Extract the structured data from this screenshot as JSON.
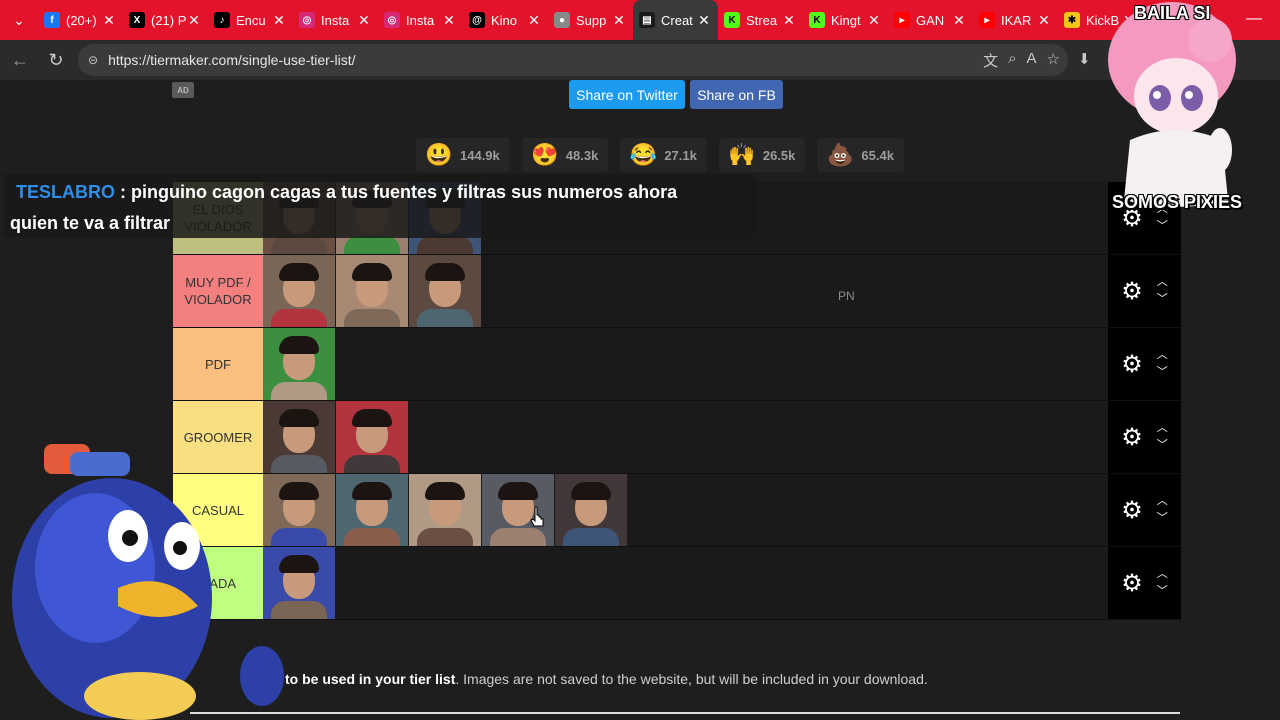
{
  "browser": {
    "tabs": [
      {
        "label": "(20+)",
        "icon": "facebook-icon",
        "color": "#1877f2",
        "glyph": "f"
      },
      {
        "label": "(21) P",
        "icon": "x-icon",
        "color": "#000000",
        "glyph": "X"
      },
      {
        "label": "Encu",
        "icon": "tiktok-icon",
        "color": "#000000",
        "glyph": "♪"
      },
      {
        "label": "Insta",
        "icon": "instagram-icon",
        "color": "#d62976",
        "glyph": "◎"
      },
      {
        "label": "Insta",
        "icon": "instagram-icon",
        "color": "#d62976",
        "glyph": "◎"
      },
      {
        "label": "Kino",
        "icon": "threads-icon",
        "color": "#000000",
        "glyph": "@"
      },
      {
        "label": "Supp",
        "icon": "avatar-icon",
        "color": "#888888",
        "glyph": "●"
      },
      {
        "label": "Creat",
        "icon": "tiermaker-icon",
        "color": "#1a1a1a",
        "glyph": "▤"
      },
      {
        "label": "Strea",
        "icon": "kick-icon",
        "color": "#53fc18",
        "glyph": "K"
      },
      {
        "label": "Kingt",
        "icon": "kick-icon",
        "color": "#53fc18",
        "glyph": "K"
      },
      {
        "label": "GAN",
        "icon": "youtube-icon",
        "color": "#ff0000",
        "glyph": "▸"
      },
      {
        "label": "IKAR",
        "icon": "youtube-icon",
        "color": "#ff0000",
        "glyph": "▸"
      },
      {
        "label": "KickB",
        "icon": "kickbot-icon",
        "color": "#f5c518",
        "glyph": "✱"
      }
    ],
    "active_tab_index": 7,
    "url": "https://tiermaker.com/single-use-tier-list/"
  },
  "page": {
    "ad_badge": "AD",
    "share_twitter": "Share on Twitter",
    "share_fb": "Share on FB",
    "reactions": [
      {
        "emoji": "😃",
        "icon": "smile-emoji-icon",
        "count": "144.9k"
      },
      {
        "emoji": "😍",
        "icon": "heart-eyes-emoji-icon",
        "count": "48.3k"
      },
      {
        "emoji": "😂",
        "icon": "laughing-emoji-icon",
        "count": "27.1k"
      },
      {
        "emoji": "🙌",
        "icon": "raised-hands-emoji-icon",
        "count": "26.5k"
      },
      {
        "emoji": "💩",
        "icon": "poop-emoji-icon",
        "count": "65.4k"
      }
    ],
    "tiers": [
      {
        "label": "EL DIOS VIOLADOR",
        "color": "#bfbf7f",
        "items": 3
      },
      {
        "label": "MUY PDF / VIOLADOR",
        "color": "#f47f7f",
        "items": 3,
        "note": "PN"
      },
      {
        "label": "PDF",
        "color": "#f9bf7f",
        "items": 1
      },
      {
        "label": "GROOMER",
        "color": "#f9df7f",
        "items": 2
      },
      {
        "label": "CASUAL",
        "color": "#ffff7f",
        "items": 5
      },
      {
        "label": "NADA",
        "color": "#bfff7f",
        "items": 1
      }
    ],
    "footer_bold": "to be used in your tier list",
    "footer_rest": ". Images are not saved to the website, but will be included in your download."
  },
  "chat": {
    "user": "TESLABRO",
    "message": " : pinguino cagon cagas a tus fuentes y filtras sus numeros ahora",
    "message2": "quien te va a filtrar"
  },
  "overlay": {
    "top_text": "BAILA SI",
    "bottom_text": "SOMOS PIXIES"
  }
}
